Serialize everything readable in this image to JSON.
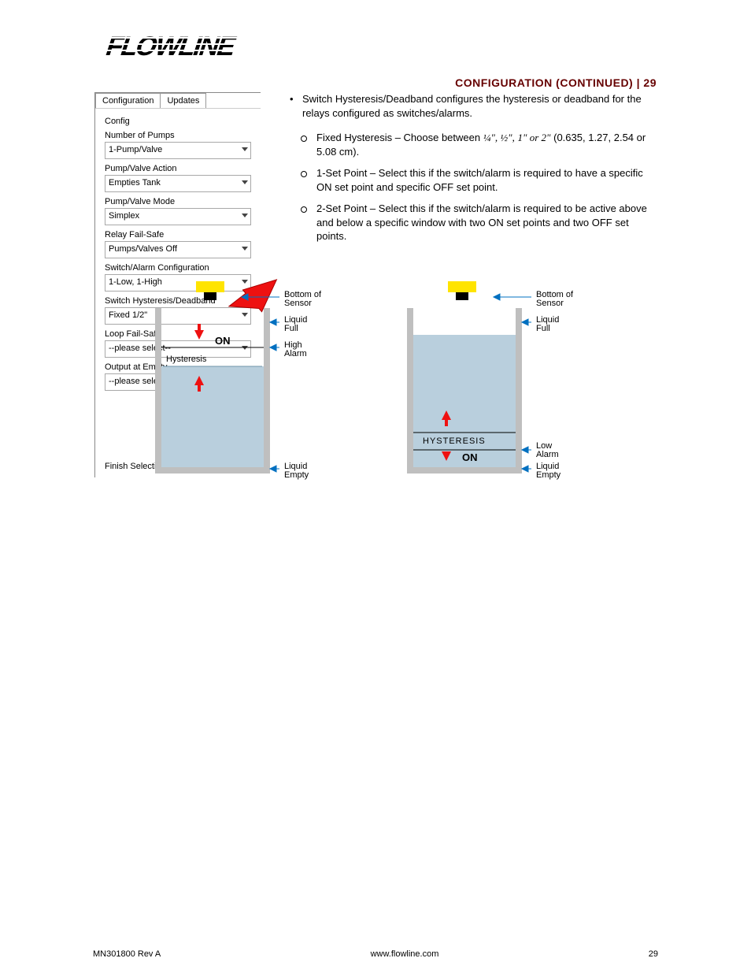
{
  "logo": {
    "text": "FLOWLINE"
  },
  "section": {
    "left": "CONFIGURATION (CONTINUED) | 29"
  },
  "panel": {
    "tabs": [
      "Configuration",
      "Updates"
    ],
    "group_title": "Config",
    "fields": {
      "pumps": {
        "label": "Number of Pumps",
        "value": "1-Pump/Valve"
      },
      "action": {
        "label": "Pump/Valve Action",
        "value": "Empties Tank"
      },
      "mode": {
        "label": "Pump/Valve Mode",
        "value": "Simplex"
      },
      "relay_fs": {
        "label": "Relay Fail-Safe",
        "value": "Pumps/Valves Off"
      },
      "switch_cfg": {
        "label": "Switch/Alarm Configuration",
        "value": "1-Low, 1-High"
      },
      "hysteresis": {
        "label": "Switch Hysteresis/Deadband",
        "value": "Fixed 1/2\""
      },
      "loop_fs": {
        "label": "Loop Fail-Safe",
        "value": "--please select--"
      },
      "out_empty": {
        "label": "Output at Empty",
        "value": "--please select--"
      }
    },
    "finish": "Finish Selections"
  },
  "text": {
    "main": "Switch Hysteresis/Deadband configures the hysteresis or deadband for the relays configured as switches/alarms.",
    "fixed": {
      "pre": "Fixed Hysteresis – Choose between ",
      "frac": "¼\", ½\",",
      "or": " ",
      "vals": "1\" or 2\"",
      "post": " (0.635, 1.27, 2.54 or 5.08 cm)."
    },
    "set1": {
      "pre": "1-Set Point – ",
      "post": "Select this if the switch/alarm is required to have a specific ON set point and specific OFF set point."
    },
    "set2": {
      "pre": "2-Set Point – ",
      "post": "Select this if the switch/alarm is required to be active above and below a specific window with two ON set points and two OFF set points."
    }
  },
  "diagram": {
    "labels": {
      "bottom_sensor": "Bottom of\nSensor",
      "liquid_full": "Liquid\nFull",
      "high_alarm": "High\nAlarm",
      "low_alarm": "Low\nAlarm",
      "liquid_empty": "Liquid\nEmpty"
    }
  },
  "footer": {
    "doc": "MN301800 Rev A",
    "company": "www.flowline.com",
    "page": "29"
  }
}
